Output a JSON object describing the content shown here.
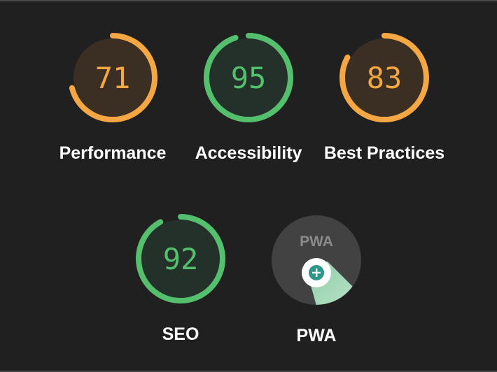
{
  "colors": {
    "background": "#202020",
    "average": "#f4a742",
    "pass": "#54c06e",
    "average_track_fill": "#3a2f22",
    "pass_track_fill": "#24302a",
    "pwa_badge": "#424242",
    "pwa_plus": "#2e9688"
  },
  "categories": [
    {
      "id": "performance",
      "label": "Performance",
      "score": "71",
      "fraction": 0.71,
      "rating": "average"
    },
    {
      "id": "accessibility",
      "label": "Accessibility",
      "score": "95",
      "fraction": 0.95,
      "rating": "pass"
    },
    {
      "id": "best-practices",
      "label": "Best Practices",
      "score": "83",
      "fraction": 0.83,
      "rating": "average"
    },
    {
      "id": "seo",
      "label": "SEO",
      "score": "92",
      "fraction": 0.92,
      "rating": "pass"
    }
  ],
  "pwa": {
    "label": "PWA",
    "badge_text": "PWA",
    "icon": "pwa-plus-icon"
  }
}
